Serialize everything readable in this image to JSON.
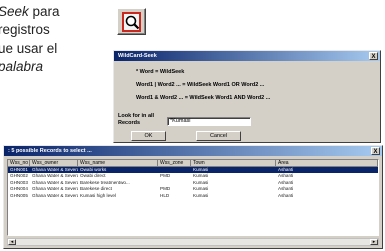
{
  "doc": {
    "line1_prefix": "Seek",
    "line1_suffix": " para",
    "line2": "registros",
    "line3": "ue usar el",
    "line4": "palabra"
  },
  "wildcard_dialog": {
    "title": "WildCard-Seek",
    "line1": "* Word = WildSeek",
    "line2": "Word1 | Word2 ... = WildSeek Word1 OR Word2 ...",
    "line3": "Word1 & Word2 ... = WildSeek Word1 AND Word2 ...",
    "look_in_label": "Look for in all Records",
    "search_value": "*Kumasi",
    "ok_label": "OK",
    "cancel_label": "Cancel",
    "close_label": "X"
  },
  "results_window": {
    "title": ": 5 possible Records to select ...",
    "close_label": "X",
    "columns": [
      "Wss_no",
      "Wss_owner",
      "Wss_name",
      "Wss_zone",
      "Town",
      "Area"
    ],
    "rows": [
      [
        "GHN001",
        "Ghana Water & Severa...",
        "Owabi works",
        "",
        "Kumasi",
        "Ashanti"
      ],
      [
        "GHN002",
        "Ghana Water & Severa...",
        "Owabi direct",
        "PMD",
        "Kumasi",
        "Ashanti"
      ],
      [
        "GHN003",
        "Ghana Water & Severa...",
        "Barekese treatmentwo...",
        "",
        "Kumasi",
        "Ashanti"
      ],
      [
        "GHN004",
        "Ghana Water & Severa...",
        "Barekese direct",
        "PMD",
        "Kumasi",
        "Ashanti"
      ],
      [
        "GHN005",
        "Ghana Water & Severa...",
        "Kumasi high level",
        "HLD",
        "Kumasi",
        "Ashanti"
      ]
    ],
    "selected_row": 0
  },
  "icons": {
    "toolbar_button": "magnifier-document-icon",
    "scroll_left": "arrow-left-icon",
    "scroll_right": "arrow-right-icon"
  },
  "colors": {
    "title_bar": "#0a246a",
    "selection": "#0a246a",
    "icon_red": "#c8281e"
  }
}
